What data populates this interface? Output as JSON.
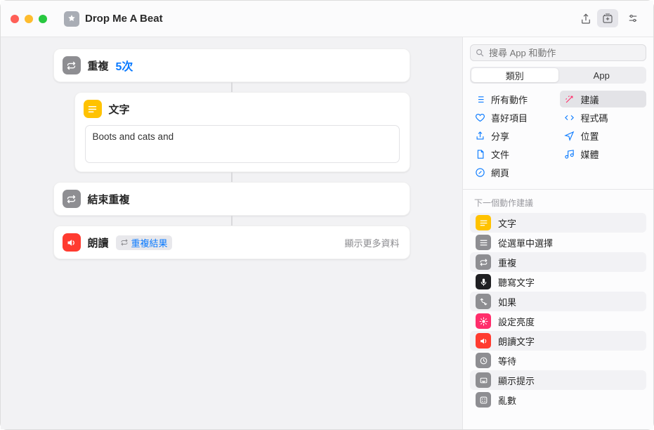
{
  "window": {
    "title": "Drop Me A Beat"
  },
  "toolbar": {
    "share": "share",
    "run": "run",
    "library_toggle": "library",
    "settings": "settings"
  },
  "canvas": {
    "repeat": {
      "label": "重複",
      "count": "5次"
    },
    "text_action": {
      "title": "文字",
      "content": "Boots and cats and"
    },
    "end_repeat": {
      "label": "結束重複"
    },
    "speak": {
      "label": "朗讀",
      "token": "重複結果",
      "more": "顯示更多資料"
    }
  },
  "panel": {
    "search_placeholder": "搜尋 App 和動作",
    "tabs": {
      "categories": "類別",
      "apps": "App"
    },
    "categories": [
      {
        "label": "所有動作",
        "icon": "list"
      },
      {
        "label": "建議",
        "icon": "wand",
        "selected": true
      },
      {
        "label": "喜好項目",
        "icon": "heart"
      },
      {
        "label": "程式碼",
        "icon": "code"
      },
      {
        "label": "分享",
        "icon": "share"
      },
      {
        "label": "位置",
        "icon": "location"
      },
      {
        "label": "文件",
        "icon": "doc"
      },
      {
        "label": "媒體",
        "icon": "media"
      },
      {
        "label": "網頁",
        "icon": "safari"
      }
    ],
    "suggestion_header": "下一個動作建議",
    "suggestions": [
      {
        "label": "文字",
        "icon": "text",
        "cls": "si-yellow"
      },
      {
        "label": "從選單中選擇",
        "icon": "menu",
        "cls": "si-grey"
      },
      {
        "label": "重複",
        "icon": "repeat",
        "cls": "si-grey"
      },
      {
        "label": "聽寫文字",
        "icon": "dictate",
        "cls": "si-dark"
      },
      {
        "label": "如果",
        "icon": "branch",
        "cls": "si-grey"
      },
      {
        "label": "設定亮度",
        "icon": "brightness",
        "cls": "si-pink"
      },
      {
        "label": "朗讀文字",
        "icon": "speak",
        "cls": "si-red"
      },
      {
        "label": "等待",
        "icon": "clock",
        "cls": "si-grey"
      },
      {
        "label": "顯示提示",
        "icon": "alert",
        "cls": "si-grey"
      },
      {
        "label": "亂數",
        "icon": "dice",
        "cls": "si-grey"
      }
    ]
  }
}
